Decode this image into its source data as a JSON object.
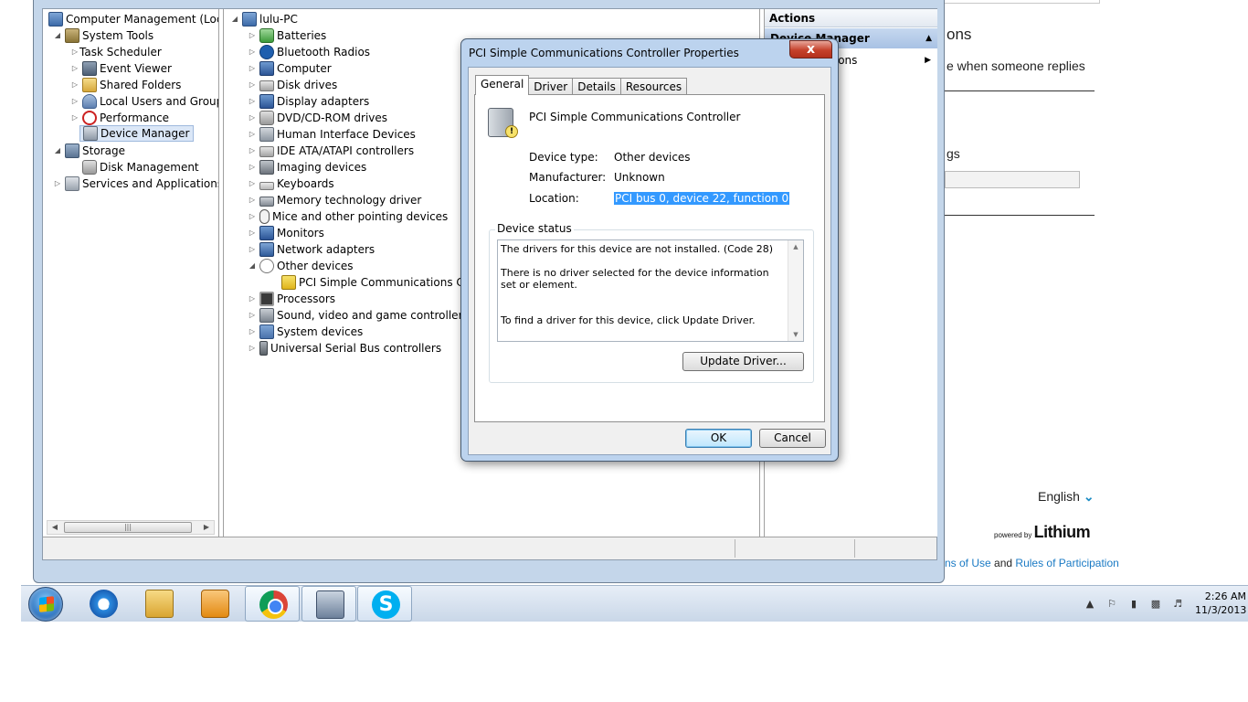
{
  "web": {
    "heading": "ons",
    "replies_text": "e when someone replies",
    "settings_text": "gs",
    "language": "English",
    "powered_by": "powered by",
    "brand": "Lithium",
    "link_terms": "ns of Use",
    "link_and": "and",
    "link_rules": "Rules of Participation"
  },
  "tree": {
    "root": "Computer Management (Local",
    "system_tools": "System Tools",
    "task_scheduler": "Task Scheduler",
    "event_viewer": "Event Viewer",
    "shared_folders": "Shared Folders",
    "local_users": "Local Users and Groups",
    "performance": "Performance",
    "device_manager": "Device Manager",
    "storage": "Storage",
    "disk_management": "Disk Management",
    "services": "Services and Applications"
  },
  "devices": {
    "pc": "lulu-PC",
    "items": [
      "Batteries",
      "Bluetooth Radios",
      "Computer",
      "Disk drives",
      "Display adapters",
      "DVD/CD-ROM drives",
      "Human Interface Devices",
      "IDE ATA/ATAPI controllers",
      "Imaging devices",
      "Keyboards",
      "Memory technology driver",
      "Mice and other pointing devices",
      "Monitors",
      "Network adapters",
      "Other devices",
      "PCI Simple Communications Cont",
      "Processors",
      "Sound, video and game controllers",
      "System devices",
      "Universal Serial Bus controllers"
    ]
  },
  "actions": {
    "header": "Actions",
    "device_manager": "Device Manager",
    "more": "More Actions"
  },
  "dialog": {
    "title": "PCI Simple Communications Controller Properties",
    "close": "x",
    "tabs": [
      "General",
      "Driver",
      "Details",
      "Resources"
    ],
    "device_name": "PCI Simple Communications Controller",
    "device_type_label": "Device type:",
    "device_type_value": "Other devices",
    "manufacturer_label": "Manufacturer:",
    "manufacturer_value": "Unknown",
    "location_label": "Location:",
    "location_value": "PCI bus 0, device 22, function 0",
    "status_legend": "Device status",
    "status_line1": "The drivers for this device are not installed. (Code 28)",
    "status_line2": "There is no driver selected for the device information set or element.",
    "status_line3": "To find a driver for this device, click Update Driver.",
    "update_driver": "Update Driver...",
    "ok": "OK",
    "cancel": "Cancel"
  },
  "taskbar": {
    "time": "2:26 AM",
    "date": "11/3/2013"
  }
}
